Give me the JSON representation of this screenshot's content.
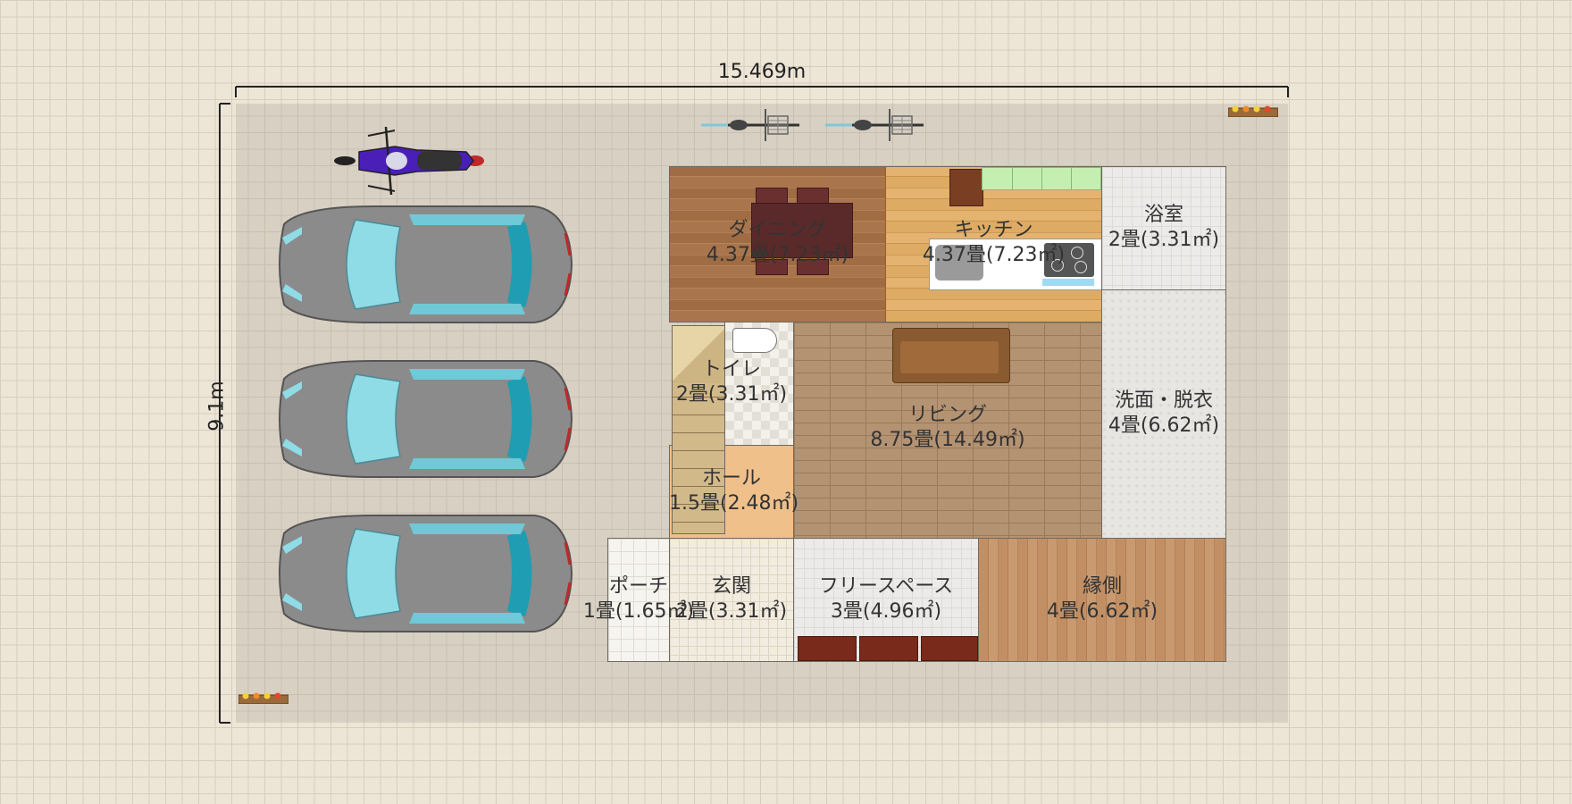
{
  "dimensions": {
    "width_label": "15.469m",
    "height_label": "9.1m"
  },
  "rooms": [
    {
      "id": "dining",
      "name": "ダイニング",
      "area": "4.37畳(7.23㎡)"
    },
    {
      "id": "kitchen",
      "name": "キッチン",
      "area": "4.37畳(7.23㎡)"
    },
    {
      "id": "bath",
      "name": "浴室",
      "area": "2畳(3.31㎡)"
    },
    {
      "id": "toilet",
      "name": "トイレ",
      "area": "2畳(3.31㎡)"
    },
    {
      "id": "living",
      "name": "リビング",
      "area": "8.75畳(14.49㎡)"
    },
    {
      "id": "washroom",
      "name": "洗面・脱衣",
      "area": "4畳(6.62㎡)"
    },
    {
      "id": "hall",
      "name": "ホール",
      "area": "1.5畳(2.48㎡)"
    },
    {
      "id": "porch",
      "name": "ポーチ",
      "area": "1畳(1.65㎡)"
    },
    {
      "id": "entrance",
      "name": "玄関",
      "area": "2畳(3.31㎡)"
    },
    {
      "id": "freespace",
      "name": "フリースペース",
      "area": "3畳(4.96㎡)"
    },
    {
      "id": "engawa",
      "name": "縁側",
      "area": "4畳(6.62㎡)"
    }
  ],
  "objects": {
    "cars": 3,
    "motorcycles": 1,
    "bicycles": 2,
    "flower_planters": 2,
    "car_color": "#8b8b8b",
    "glass_color": "#8fdbe6",
    "motorcycle_color": "#4a1fb8"
  }
}
